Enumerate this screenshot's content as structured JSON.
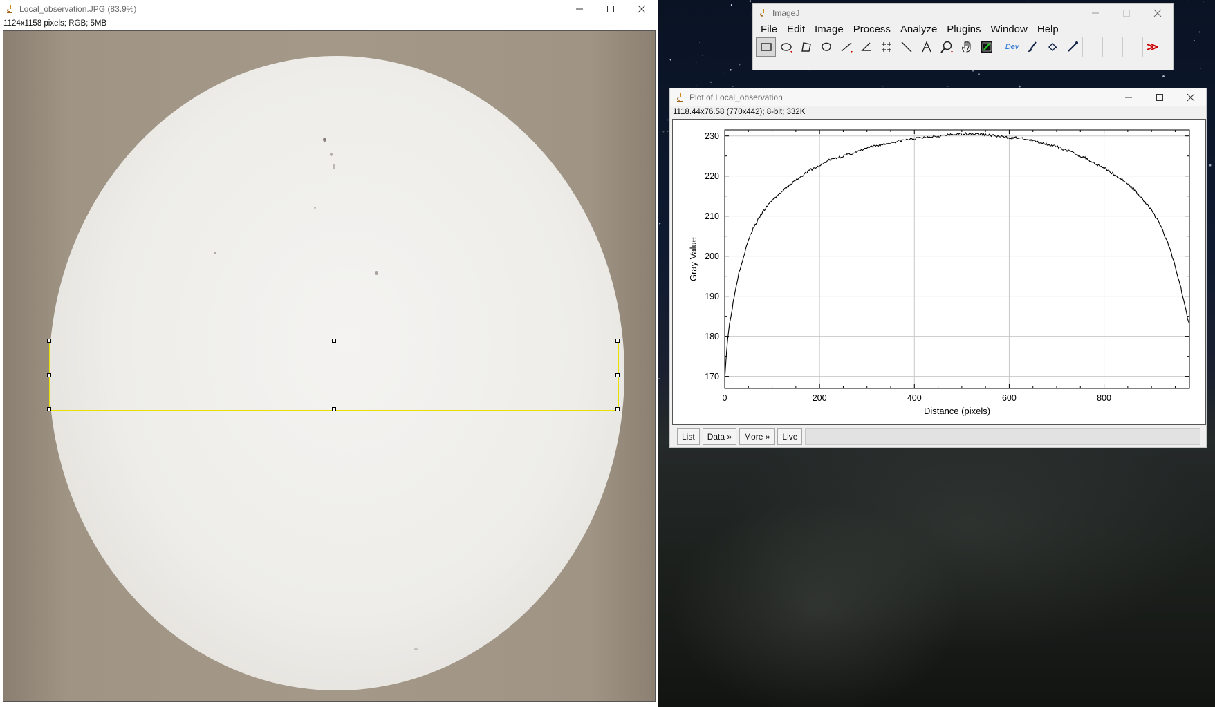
{
  "image_window": {
    "title": "Local_observation.JPG (83.9%)",
    "info": "1124x1158 pixels; RGB; 5MB"
  },
  "imagej_window": {
    "title": "ImageJ",
    "menus": [
      "File",
      "Edit",
      "Image",
      "Process",
      "Analyze",
      "Plugins",
      "Window",
      "Help"
    ],
    "tools": [
      "rectangle-tool-icon",
      "oval-tool-icon",
      "polygon-tool-icon",
      "freehand-tool-icon",
      "line-tool-icon",
      "angle-tool-icon",
      "multipoint-tool-icon",
      "wand-tool-icon",
      "text-tool-icon",
      "magnifier-tool-icon",
      "hand-tool-icon",
      "color-picker-tool-icon",
      "dev-menu-icon",
      "brush-tool-icon",
      "flood-fill-tool-icon",
      "pipette-tool-icon",
      "more-tools-icon"
    ],
    "dev_label": "Dev",
    "more_label": "≫"
  },
  "plot_window": {
    "title": "Plot of Local_observation",
    "info": "1118.44x76.58   (770x442); 8-bit; 332K",
    "buttons": {
      "list": "List",
      "data": "Data »",
      "more": "More »",
      "live": "Live"
    }
  },
  "chart_data": {
    "type": "line",
    "title": "",
    "xlabel": "Distance (pixels)",
    "ylabel": "Gray Value",
    "xlim": [
      0,
      980
    ],
    "ylim": [
      167,
      231.5
    ],
    "xticks": [
      0,
      200,
      400,
      600,
      800
    ],
    "yticks": [
      170,
      180,
      190,
      200,
      210,
      220,
      230
    ],
    "grid": true,
    "series": [
      {
        "name": "",
        "x": [
          0,
          5,
          10,
          20,
          30,
          40,
          50,
          60,
          80,
          100,
          120,
          150,
          180,
          200,
          220,
          250,
          280,
          300,
          330,
          350,
          380,
          400,
          430,
          450,
          480,
          500,
          520,
          540,
          560,
          580,
          600,
          620,
          640,
          660,
          680,
          700,
          720,
          740,
          760,
          780,
          800,
          820,
          840,
          860,
          880,
          900,
          920,
          940,
          950,
          960,
          970,
          975,
          980
        ],
        "y": [
          169.5,
          178,
          183,
          190,
          196,
          200,
          204,
          207,
          211,
          214,
          216,
          219,
          221.5,
          222.5,
          224,
          225,
          226,
          227,
          227.8,
          228.3,
          229,
          229.3,
          229.8,
          230,
          230.3,
          230.5,
          230.6,
          230.4,
          230.2,
          229.8,
          229.6,
          229.5,
          229,
          228.5,
          228,
          227.3,
          226.5,
          225.5,
          224.5,
          223.2,
          222,
          220.5,
          219,
          217,
          214.5,
          211.5,
          207.5,
          201.5,
          197.5,
          193,
          188,
          185,
          183
        ]
      }
    ]
  }
}
